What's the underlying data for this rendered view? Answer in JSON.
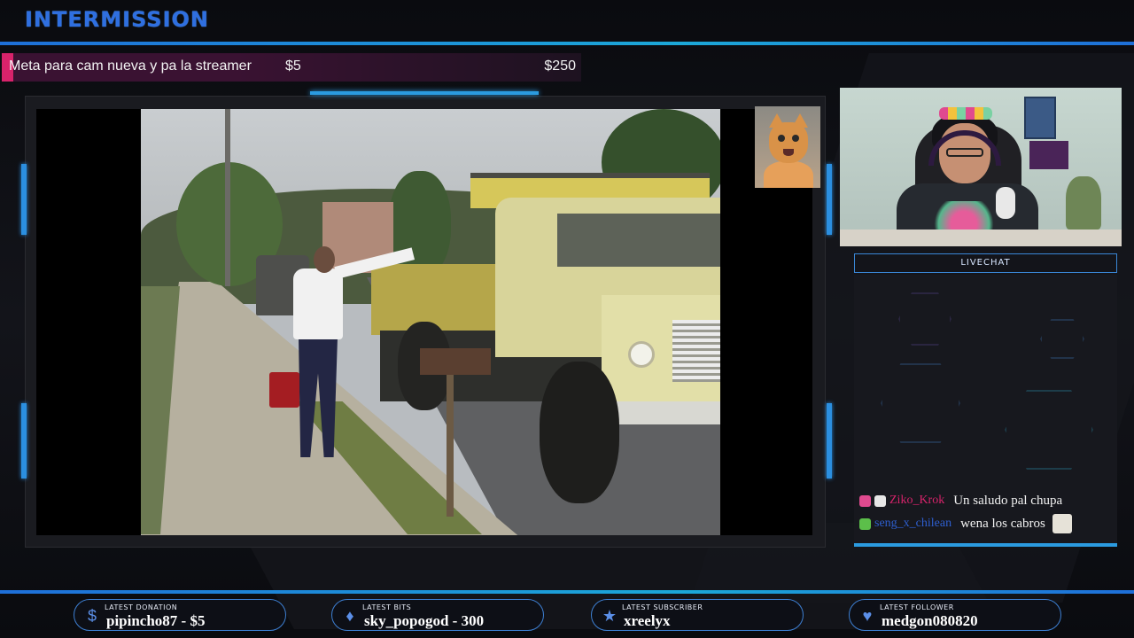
{
  "header": {
    "title": "INTERMISSION"
  },
  "goal": {
    "label": "Meta para cam nueva y pa la streamer",
    "current": "$5",
    "target": "$250",
    "progress": 0.02
  },
  "chat": {
    "header": "LIVECHAT",
    "messages": [
      {
        "user": "Ziko_Krok",
        "user_color": "#d8236b",
        "text": "Un saludo pal chupa",
        "emote": ""
      },
      {
        "user": "seng_x_chilean",
        "user_color": "#2e5fd0",
        "text": "wena los cabros",
        "emote": "cat-emote"
      }
    ]
  },
  "stats": [
    {
      "label": "LATEST DONATION",
      "value": "pipincho87 - $5",
      "icon": "dollar-icon"
    },
    {
      "label": "LATEST BITS",
      "value": "sky_popogod - 300",
      "icon": "bits-icon"
    },
    {
      "label": "LATEST SUBSCRIBER",
      "value": "xreelyx",
      "icon": "star-icon"
    },
    {
      "label": "LATEST FOLLOWER",
      "value": "medgon080820",
      "icon": "heart-icon"
    }
  ],
  "colors": {
    "accent": "#2b9be0",
    "title": "#2f6fe0",
    "goal_accent": "#d8236b"
  }
}
